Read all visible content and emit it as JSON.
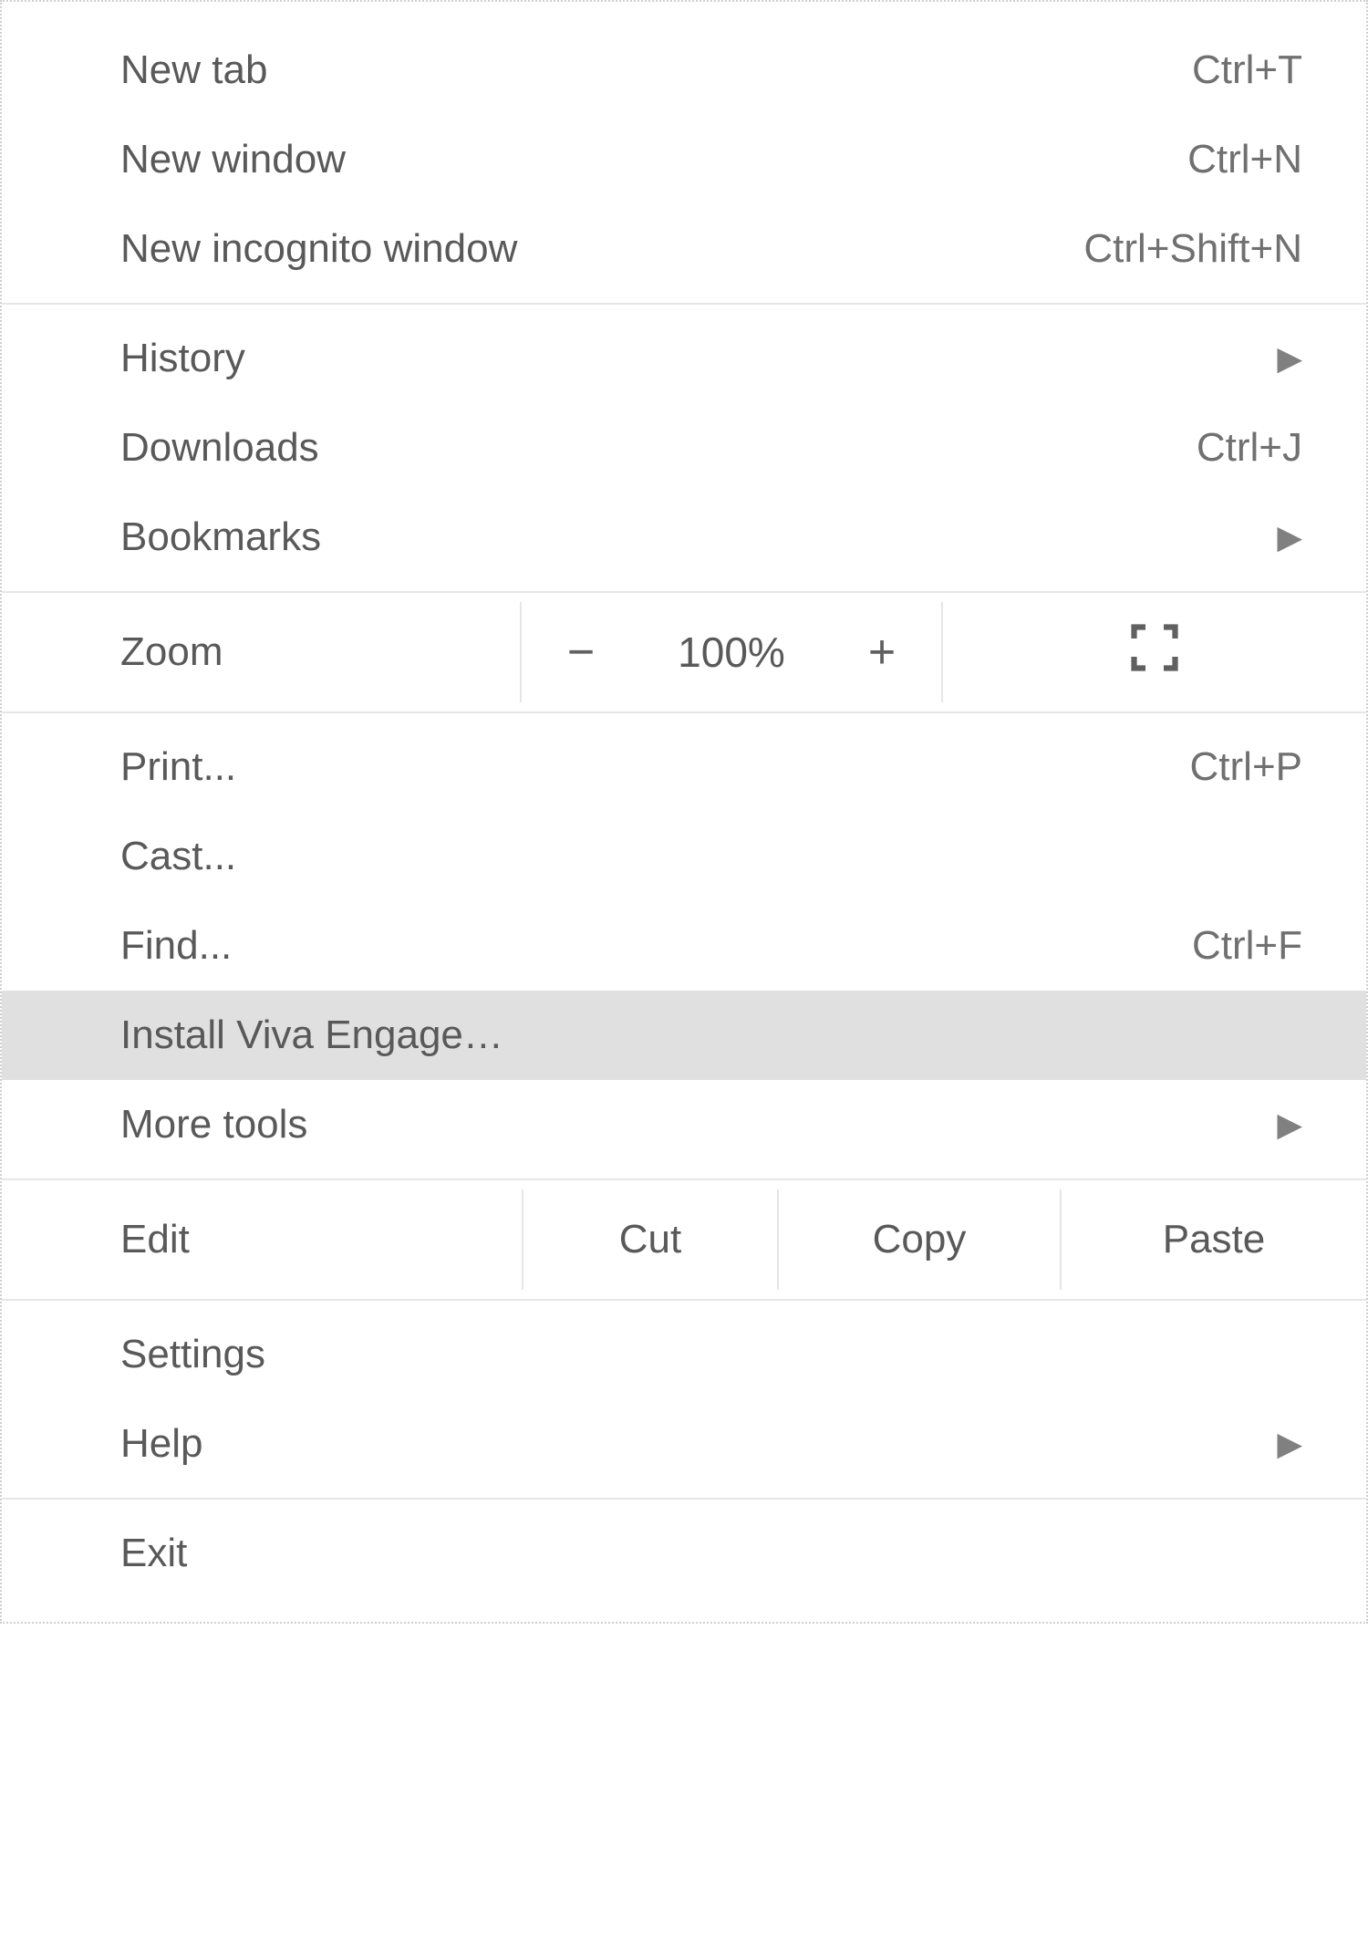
{
  "menu": {
    "newTab": {
      "label": "New tab",
      "shortcut": "Ctrl+T"
    },
    "newWindow": {
      "label": "New window",
      "shortcut": "Ctrl+N"
    },
    "newIncognito": {
      "label": "New incognito window",
      "shortcut": "Ctrl+Shift+N"
    },
    "history": {
      "label": "History"
    },
    "downloads": {
      "label": "Downloads",
      "shortcut": "Ctrl+J"
    },
    "bookmarks": {
      "label": "Bookmarks"
    },
    "zoom": {
      "label": "Zoom",
      "value": "100%",
      "minus": "−",
      "plus": "+"
    },
    "print": {
      "label": "Print...",
      "shortcut": "Ctrl+P"
    },
    "cast": {
      "label": "Cast..."
    },
    "find": {
      "label": "Find...",
      "shortcut": "Ctrl+F"
    },
    "install": {
      "label": "Install Viva Engage…"
    },
    "moreTools": {
      "label": "More tools"
    },
    "edit": {
      "label": "Edit",
      "cut": "Cut",
      "copy": "Copy",
      "paste": "Paste"
    },
    "settings": {
      "label": "Settings"
    },
    "help": {
      "label": "Help"
    },
    "exit": {
      "label": "Exit"
    }
  },
  "icons": {
    "submenuArrow": "▶"
  }
}
